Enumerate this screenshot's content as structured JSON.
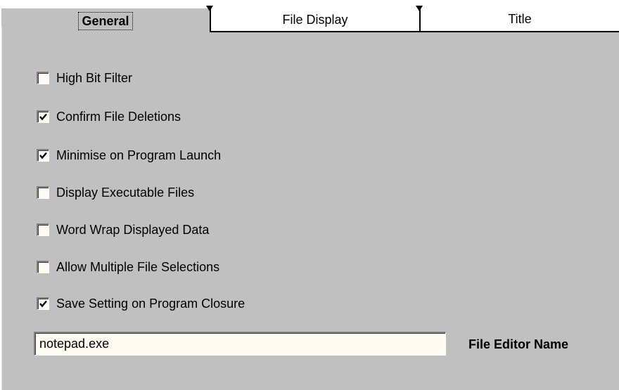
{
  "tabs": [
    {
      "label": "General",
      "selected": true
    },
    {
      "label": "File Display",
      "selected": false
    },
    {
      "label": "Title",
      "selected": false
    }
  ],
  "options": [
    {
      "label": "High Bit Filter",
      "checked": false
    },
    {
      "label": "Confirm File Deletions",
      "checked": true
    },
    {
      "label": "Minimise on Program Launch",
      "checked": true
    },
    {
      "label": "Display Executable Files",
      "checked": false
    },
    {
      "label": "Word Wrap Displayed Data",
      "checked": false
    },
    {
      "label": "Allow Multiple File Selections",
      "checked": false
    },
    {
      "label": "Save Setting on Program Closure",
      "checked": true
    }
  ],
  "editor": {
    "value": "notepad.exe",
    "label": "File Editor Name"
  },
  "colors": {
    "face": "#c0c0c0",
    "field": "#fffbf0",
    "highlight": "#ffffff",
    "shadow": "#808080"
  },
  "icons": {
    "check": "checkmark-icon",
    "tab_notch": "tab-notch-icon"
  }
}
